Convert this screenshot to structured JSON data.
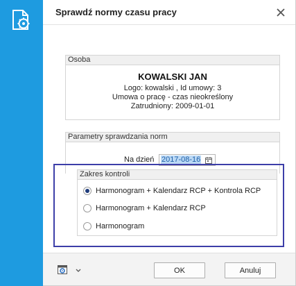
{
  "dialog": {
    "title": "Sprawdź normy czasu pracy"
  },
  "person": {
    "header": "Osoba",
    "name": "KOWALSKI JAN",
    "login_line": "Logo: kowalski , Id umowy: 3",
    "contract_line": "Umowa o pracę - czas nieokreślony",
    "hired_line": "Zatrudniony: 2009-01-01"
  },
  "params": {
    "header": "Parametry sprawdzania norm",
    "date_label": "Na dzień",
    "date_value": "2017-08-16"
  },
  "scope": {
    "header": "Zakres kontroli",
    "options": [
      {
        "label": "Harmonogram + Kalendarz RCP + Kontrola RCP",
        "selected": true
      },
      {
        "label": "Harmonogram + Kalendarz RCP",
        "selected": false
      },
      {
        "label": "Harmonogram",
        "selected": false
      }
    ]
  },
  "footer": {
    "ok_label": "OK",
    "cancel_label": "Anuluj"
  },
  "icons": {
    "sidebar": "document-gear-icon",
    "close": "close-icon",
    "calendar": "calendar-icon",
    "tools": "calendar-gear-icon",
    "chevron": "chevron-down-icon"
  },
  "colors": {
    "sidebar": "#1e9be0",
    "highlight_box": "#3c3ea8",
    "date_selection": "#bcd9f5"
  }
}
